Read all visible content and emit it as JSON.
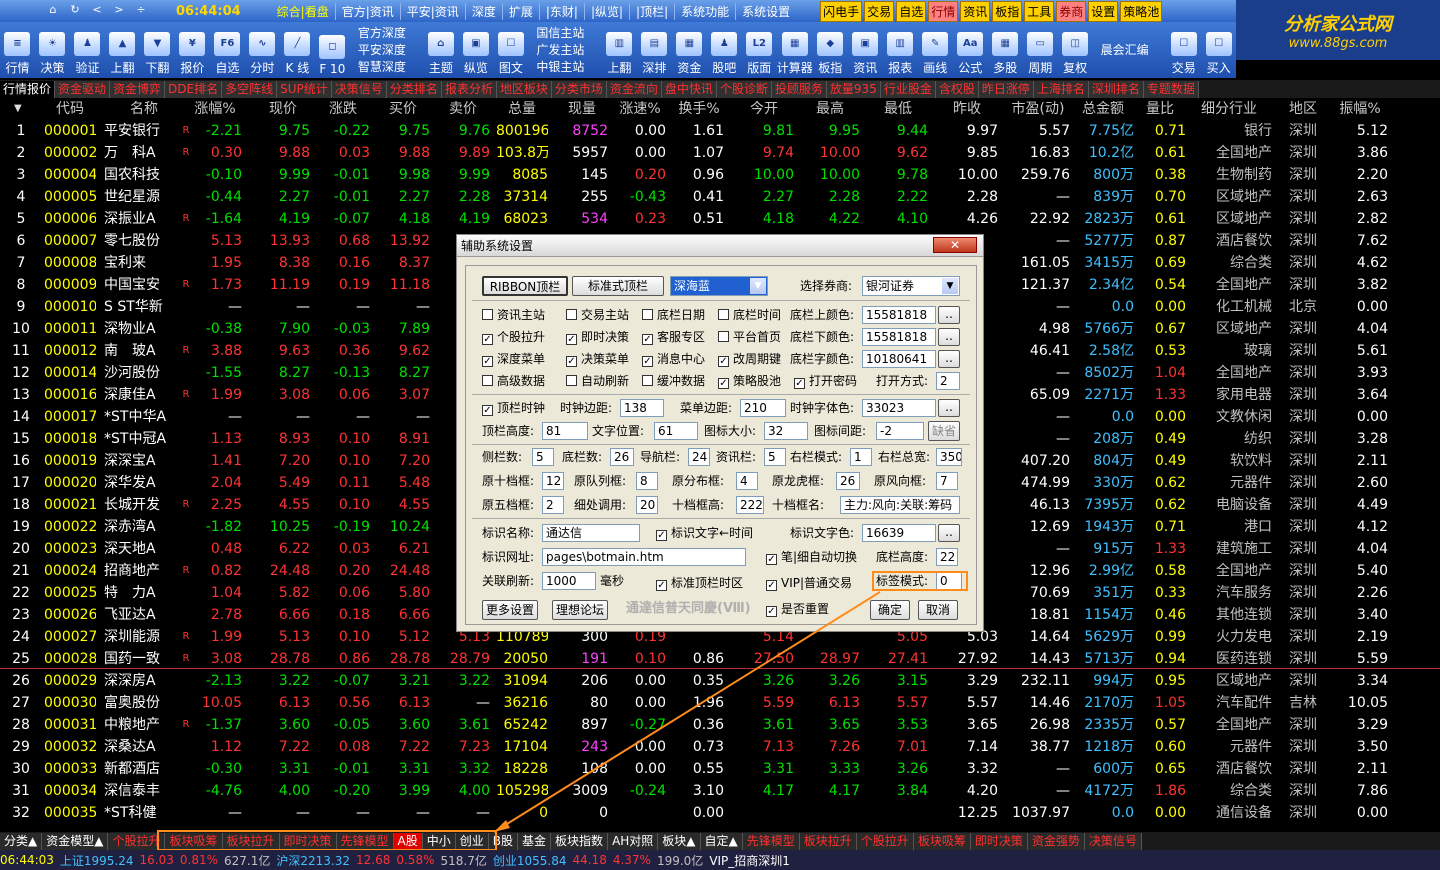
{
  "topbar": {
    "clock": "06:44:04",
    "nav": [
      "⌂",
      "↻",
      "<",
      ">",
      "÷"
    ],
    "menus": [
      "综合|看盘",
      "官方|资讯",
      "平安|资讯",
      "深度",
      "扩展",
      "|东财|",
      "|纵览|",
      "|顶栏|",
      "系统功能",
      "系统设置"
    ],
    "quick": [
      "闪电手",
      "交易",
      "自选",
      "行情",
      "资讯",
      "板指",
      "工具",
      "券商",
      "设置",
      "策略池"
    ]
  },
  "logo": {
    "title": "分析家公式网",
    "url": "www.88gs.com"
  },
  "toolbar": {
    "items1": [
      [
        "行情",
        "≡"
      ],
      [
        "决策",
        "☀"
      ],
      [
        "验证",
        "♟"
      ],
      [
        "上翻",
        "▲"
      ],
      [
        "下翻",
        "▼"
      ],
      [
        "报价",
        "¥"
      ],
      [
        "自选",
        "F6"
      ],
      [
        "分时",
        "∿"
      ],
      [
        "K 线",
        "╱"
      ],
      [
        "F 10",
        "◻"
      ]
    ],
    "stack1": [
      "官方深度",
      "平安深度",
      "智慧深度"
    ],
    "items2": [
      [
        "主题",
        "⌂"
      ],
      [
        "纵览",
        "▣"
      ],
      [
        "图文",
        "☐"
      ]
    ],
    "stack2": [
      "国信主站",
      "广发主站",
      "中银主站"
    ],
    "items3": [
      [
        "上翻",
        "▥"
      ],
      [
        "深排",
        "▤"
      ],
      [
        "资金",
        "▦"
      ],
      [
        "股吧",
        "♟"
      ],
      [
        "版面",
        "L2"
      ],
      [
        "计算器",
        "▦"
      ],
      [
        "板指",
        "◆"
      ],
      [
        "资讯",
        "▣"
      ],
      [
        "报表",
        "▥"
      ],
      [
        "画线",
        "✎"
      ],
      [
        "公式",
        "Aa"
      ],
      [
        "多股",
        "▦"
      ],
      [
        "周期",
        "▭"
      ],
      [
        "复权",
        "◫"
      ]
    ],
    "stack3": [
      "晨会汇编"
    ],
    "items4": [
      [
        "交易",
        "☐"
      ],
      [
        "买入",
        "☐"
      ]
    ]
  },
  "tabs": [
    "行情报价",
    "资金驱动",
    "资金博弈",
    "DDE排名",
    "多空阵线",
    "SUP统计",
    "决策信号",
    "分类排名",
    "报表分析",
    "地区板块",
    "分类市场",
    "资金流向",
    "盘中快讯",
    "个股诊断",
    "投顾服务",
    "放量935",
    "行业股金",
    "含权股",
    "昨日涨停",
    "上海排名",
    "深圳排名",
    "专题数据"
  ],
  "headers": [
    "代码",
    "名称",
    "",
    "涨幅%",
    "现价",
    "涨跌",
    "买价",
    "卖价",
    "总量",
    "现量",
    "涨速%",
    "换手%",
    "今开",
    "最高",
    "最低",
    "昨收",
    "市盈(动)",
    "总金额",
    "量比",
    "细分行业",
    "地区",
    "振幅%"
  ],
  "rows": [
    [
      "1",
      "000001",
      "平安银行",
      "R",
      "-2.21",
      "9.75",
      "-0.22",
      "9.75",
      "9.76",
      "800196",
      "8752",
      "0.00",
      "1.61",
      "9.81",
      "9.95",
      "9.44",
      "9.97",
      "5.57",
      "7.75亿",
      "0.71",
      "银行",
      "深圳",
      "5.12"
    ],
    [
      "2",
      "000002",
      "万　科A",
      "R",
      "0.30",
      "9.88",
      "0.03",
      "9.88",
      "9.89",
      "103.8万",
      "5957",
      "0.00",
      "1.07",
      "9.74",
      "10.00",
      "9.62",
      "9.85",
      "16.83",
      "10.2亿",
      "0.61",
      "全国地产",
      "深圳",
      "3.86"
    ],
    [
      "3",
      "000004",
      "国农科技",
      "",
      "-0.10",
      "9.99",
      "-0.01",
      "9.98",
      "9.99",
      "8085",
      "145",
      "0.20",
      "0.96",
      "10.00",
      "10.00",
      "9.78",
      "10.00",
      "259.76",
      "800万",
      "0.38",
      "生物制药",
      "深圳",
      "2.20"
    ],
    [
      "4",
      "000005",
      "世纪星源",
      "",
      "-0.44",
      "2.27",
      "-0.01",
      "2.27",
      "2.28",
      "37314",
      "255",
      "-0.43",
      "0.41",
      "2.27",
      "2.28",
      "2.22",
      "2.28",
      "—",
      "839万",
      "0.70",
      "区域地产",
      "深圳",
      "2.63"
    ],
    [
      "5",
      "000006",
      "深振业A",
      "R",
      "-1.64",
      "4.19",
      "-0.07",
      "4.18",
      "4.19",
      "68023",
      "534",
      "0.23",
      "0.51",
      "4.18",
      "4.22",
      "4.10",
      "4.26",
      "22.92",
      "2823万",
      "0.61",
      "区域地产",
      "深圳",
      "2.82"
    ],
    [
      "6",
      "000007",
      "零七股份",
      "",
      "5.13",
      "13.93",
      "0.68",
      "13.92",
      "",
      "",
      "",
      "",
      "",
      "",
      "",
      "",
      "",
      "—",
      "5277万",
      "0.87",
      "酒店餐饮",
      "深圳",
      "7.62"
    ],
    [
      "7",
      "000008",
      "宝利来",
      "",
      "1.95",
      "8.38",
      "0.16",
      "8.37",
      "",
      "",
      "",
      "",
      "",
      "",
      "",
      "",
      "",
      "161.05",
      "3415万",
      "0.69",
      "综合类",
      "深圳",
      "4.62"
    ],
    [
      "8",
      "000009",
      "中国宝安",
      "R",
      "1.73",
      "11.19",
      "0.19",
      "11.18",
      "",
      "",
      "",
      "",
      "",
      "",
      "",
      "",
      "",
      "121.37",
      "2.34亿",
      "0.54",
      "全国地产",
      "深圳",
      "3.82"
    ],
    [
      "9",
      "000010",
      "S ST华新",
      "",
      "—",
      "—",
      "—",
      "—",
      "",
      "",
      "",
      "",
      "",
      "",
      "",
      "",
      "",
      "—",
      "0.0",
      "0.00",
      "化工机械",
      "北京",
      "0.00"
    ],
    [
      "10",
      "000011",
      "深物业A",
      "",
      "-0.38",
      "7.90",
      "-0.03",
      "7.89",
      "",
      "",
      "",
      "",
      "",
      "",
      "",
      "",
      "",
      "4.98",
      "5766万",
      "0.67",
      "区域地产",
      "深圳",
      "4.04"
    ],
    [
      "11",
      "000012",
      "南　玻A",
      "R",
      "3.88",
      "9.63",
      "0.36",
      "9.62",
      "",
      "",
      "",
      "",
      "",
      "",
      "",
      "",
      "",
      "46.41",
      "2.58亿",
      "0.53",
      "玻璃",
      "深圳",
      "5.61"
    ],
    [
      "12",
      "000014",
      "沙河股份",
      "",
      "-1.55",
      "8.27",
      "-0.13",
      "8.27",
      "",
      "",
      "",
      "",
      "",
      "",
      "",
      "",
      "",
      "—",
      "8502万",
      "1.04",
      "全国地产",
      "深圳",
      "3.93"
    ],
    [
      "13",
      "000016",
      "深康佳A",
      "R",
      "1.99",
      "3.08",
      "0.06",
      "3.07",
      "",
      "",
      "",
      "",
      "",
      "",
      "",
      "",
      "",
      "65.09",
      "2271万",
      "1.33",
      "家用电器",
      "深圳",
      "3.64"
    ],
    [
      "14",
      "000017",
      "*ST中华A",
      "",
      "—",
      "—",
      "—",
      "—",
      "",
      "",
      "",
      "",
      "",
      "",
      "",
      "",
      "",
      "—",
      "0.0",
      "0.00",
      "文教休闲",
      "深圳",
      "0.00"
    ],
    [
      "15",
      "000018",
      "*ST中冠A",
      "",
      "1.13",
      "8.93",
      "0.10",
      "8.91",
      "",
      "",
      "",
      "",
      "",
      "",
      "",
      "",
      "",
      "—",
      "208万",
      "0.49",
      "纺织",
      "深圳",
      "3.28"
    ],
    [
      "16",
      "000019",
      "深深宝A",
      "",
      "1.41",
      "7.20",
      "0.10",
      "7.20",
      "",
      "",
      "",
      "",
      "",
      "",
      "",
      "",
      "",
      "407.20",
      "804万",
      "0.49",
      "软饮料",
      "深圳",
      "2.11"
    ],
    [
      "17",
      "000020",
      "深华发A",
      "",
      "2.04",
      "5.49",
      "0.11",
      "5.48",
      "",
      "",
      "",
      "",
      "",
      "",
      "",
      "",
      "",
      "474.99",
      "330万",
      "0.62",
      "元器件",
      "深圳",
      "2.60"
    ],
    [
      "18",
      "000021",
      "长城开发",
      "R",
      "2.25",
      "4.55",
      "0.10",
      "4.55",
      "",
      "",
      "",
      "",
      "",
      "",
      "",
      "",
      "",
      "46.13",
      "7395万",
      "0.62",
      "电脑设备",
      "深圳",
      "4.49"
    ],
    [
      "19",
      "000022",
      "深赤湾A",
      "",
      "-1.82",
      "10.25",
      "-0.19",
      "10.24",
      "",
      "",
      "",
      "",
      "",
      "",
      "",
      "",
      "",
      "12.69",
      "1943万",
      "0.71",
      "港口",
      "深圳",
      "4.12"
    ],
    [
      "20",
      "000023",
      "深天地A",
      "",
      "0.48",
      "6.22",
      "0.03",
      "6.21",
      "",
      "",
      "",
      "",
      "",
      "",
      "",
      "",
      "",
      "—",
      "915万",
      "1.33",
      "建筑施工",
      "深圳",
      "4.04"
    ],
    [
      "21",
      "000024",
      "招商地产",
      "R",
      "0.82",
      "24.48",
      "0.20",
      "24.48",
      "",
      "",
      "",
      "",
      "",
      "",
      "",
      "",
      "",
      "12.96",
      "2.99亿",
      "0.58",
      "全国地产",
      "深圳",
      "5.40"
    ],
    [
      "22",
      "000025",
      "特　力A",
      "",
      "1.04",
      "5.82",
      "0.06",
      "5.80",
      "",
      "",
      "",
      "",
      "",
      "",
      "",
      "",
      "",
      "70.69",
      "351万",
      "0.33",
      "汽车服务",
      "深圳",
      "2.26"
    ],
    [
      "23",
      "000026",
      "飞亚达A",
      "",
      "2.78",
      "6.66",
      "0.18",
      "6.66",
      "",
      "",
      "",
      "",
      "",
      "",
      "",
      "",
      "",
      "18.81",
      "1154万",
      "0.46",
      "其他连锁",
      "深圳",
      "3.40"
    ],
    [
      "24",
      "000027",
      "深圳能源",
      "R",
      "1.99",
      "5.13",
      "0.10",
      "5.12",
      "5.13",
      "110789",
      "300",
      "0.19",
      "",
      "5.14",
      "",
      "5.05",
      "5.03",
      "14.64",
      "5629万",
      "0.99",
      "火力发电",
      "深圳",
      "2.19"
    ],
    [
      "25",
      "000028",
      "国药一致",
      "R",
      "3.08",
      "28.78",
      "0.86",
      "28.78",
      "28.79",
      "20050",
      "191",
      "0.10",
      "0.86",
      "27.50",
      "28.97",
      "27.41",
      "27.92",
      "14.43",
      "5713万",
      "0.94",
      "医药连锁",
      "深圳",
      "5.59"
    ],
    [
      "26",
      "000029",
      "深深房A",
      "",
      "-2.13",
      "3.22",
      "-0.07",
      "3.21",
      "3.22",
      "31094",
      "206",
      "0.00",
      "0.35",
      "3.26",
      "3.26",
      "3.15",
      "3.29",
      "232.11",
      "994万",
      "0.95",
      "区域地产",
      "深圳",
      "3.34"
    ],
    [
      "27",
      "000030",
      "富奥股份",
      "",
      "10.05",
      "6.13",
      "0.56",
      "6.13",
      "—",
      "36216",
      "80",
      "0.00",
      "1.96",
      "5.59",
      "6.13",
      "5.57",
      "5.57",
      "14.46",
      "2170万",
      "1.05",
      "汽车配件",
      "吉林",
      "10.05"
    ],
    [
      "28",
      "000031",
      "中粮地产",
      "R",
      "-1.37",
      "3.60",
      "-0.05",
      "3.60",
      "3.61",
      "65242",
      "897",
      "-0.27",
      "0.36",
      "3.61",
      "3.65",
      "3.53",
      "3.65",
      "26.98",
      "2335万",
      "0.57",
      "全国地产",
      "深圳",
      "3.29"
    ],
    [
      "29",
      "000032",
      "深桑达A",
      "",
      "1.12",
      "7.22",
      "0.08",
      "7.22",
      "7.23",
      "17104",
      "243",
      "0.00",
      "0.73",
      "7.13",
      "7.26",
      "7.01",
      "7.14",
      "38.77",
      "1218万",
      "0.60",
      "元器件",
      "深圳",
      "3.50"
    ],
    [
      "30",
      "000033",
      "新都酒店",
      "",
      "-0.30",
      "3.31",
      "-0.01",
      "3.31",
      "3.32",
      "18228",
      "108",
      "0.00",
      "0.55",
      "3.31",
      "3.33",
      "3.26",
      "3.32",
      "—",
      "600万",
      "0.65",
      "酒店餐饮",
      "深圳",
      "2.11"
    ],
    [
      "31",
      "000034",
      "深信泰丰",
      "",
      "-4.76",
      "4.00",
      "-0.20",
      "3.99",
      "4.00",
      "105298",
      "3009",
      "-0.24",
      "3.10",
      "4.17",
      "4.17",
      "3.84",
      "4.20",
      "—",
      "4172万",
      "1.86",
      "综合类",
      "深圳",
      "7.86"
    ],
    [
      "32",
      "000035",
      "*ST科健",
      "",
      "—",
      "—",
      "—",
      "—",
      "—",
      "0",
      "0",
      "",
      "0.00",
      "",
      "",
      "",
      "12.25",
      "1037.97",
      "0.0",
      "0.00",
      "通信设备",
      "深圳",
      "0.00"
    ]
  ],
  "bottomtabs": [
    "分类▲",
    "资金模型▲",
    "个股拉升",
    "板块吸筹",
    "板块拉升",
    "即时决策",
    "先锋模型",
    "A股",
    "中小",
    "创业",
    "B股",
    "基金",
    "板块指数",
    "AH对照",
    "板块▲",
    "自定▲",
    "先锋模型",
    "板块拉升",
    "个股拉升",
    "板块吸筹",
    "即时决策",
    "资金强势",
    "决策信号"
  ],
  "status": {
    "time": "06:44:03",
    "sh": "上证1995.24",
    "sh_chg": "16.03",
    "sh_pct": "0.81%",
    "sh_amt": "627.1亿",
    "hs": "沪深2213.32",
    "hs_chg": "12.68",
    "hs_pct": "0.58%",
    "hs_amt": "518.7亿",
    "cy": "创业1055.84",
    "cy_chg": "44.18",
    "cy_pct": "4.37%",
    "cy_amt": "199.0亿",
    "broker": "VIP_招商深圳1"
  },
  "dialog": {
    "title": "辅助系统设置",
    "close": "✕",
    "btn_ribbon": "RIBBON顶栏",
    "btn_std": "标准式顶栏",
    "theme": "深海蓝",
    "broker_label": "选择券商:",
    "broker": "银河证券",
    "c1": [
      "资讯主站",
      "交易主站",
      "底栏日期",
      "底栏时间"
    ],
    "bottom_up_label": "底栏上颜色:",
    "bottom_up": "15581818",
    "c2": [
      "个股拉升",
      "即时决策",
      "客服专区",
      "平台首页"
    ],
    "bottom_down_label": "底栏下颜色:",
    "bottom_down": "15581818",
    "c3": [
      "深度菜单",
      "决策菜单",
      "消息中心",
      "改周期键"
    ],
    "bottom_font_label": "底栏字颜色:",
    "bottom_font": "10180641",
    "c4": [
      "高级数据",
      "自动刷新",
      "缓冲数据",
      "策略股池",
      "打开密码"
    ],
    "open_mode_label": "打开方式:",
    "open_mode": "2",
    "clock_label": "顶栏时钟",
    "clock_margin_label": "时钟边距:",
    "clock_margin": "138",
    "menu_margin_label": "菜单边距:",
    "menu_margin": "210",
    "clock_font_label": "时钟字体色:",
    "clock_font": "33023",
    "top_h_label": "顶栏高度:",
    "top_h": "81",
    "text_pos_label": "文字位置:",
    "text_pos": "61",
    "icon_size_label": "图标大小:",
    "icon_size": "32",
    "icon_gap_label": "图标间距:",
    "icon_gap": "-2",
    "default": "缺省",
    "side_label": "侧栏数:",
    "side": "5",
    "bottom_cnt_label": "底栏数:",
    "bottom_cnt": "26",
    "nav_label": "导航栏:",
    "nav": "24",
    "info_label": "资讯栏:",
    "info": "5",
    "right_mode_label": "右栏模式:",
    "right_mode": "1",
    "right_total_label": "右栏总宽:",
    "right_total": "350",
    "r10_label": "原十档框:",
    "r10": "12",
    "rq_label": "原队列框:",
    "rq": "8",
    "rd_label": "原分布框:",
    "rd": "4",
    "rl_label": "原龙虎框:",
    "rl": "26",
    "rr_label": "原风向框:",
    "rr": "7",
    "r5_label": "原五档框:",
    "r5": "2",
    "tune_label": "细处调用:",
    "tune": "20",
    "ten_h_label": "十档框高:",
    "ten_h": "222",
    "ten_name_label": "十档框名:",
    "ten_name": "主力:风向:关联:筹码",
    "mark_name_label": "标识名称:",
    "mark_name": "通达信",
    "mark_time": "标识文字←时间",
    "mark_color_label": "标识文字色:",
    "mark_color": "16639",
    "mark_url_label": "标识网址:",
    "mark_url": "pages\\botmain.htm",
    "pen_auto": "笔|细自动切换",
    "bottom_h_label": "底栏高度:",
    "bottom_h": "22",
    "rel_refresh_label": "关联刷新:",
    "rel_refresh": "1000",
    "ms": "毫秒",
    "std_top": "标准顶栏时区",
    "vip": "VIP|普通交易",
    "sign_mode_label": "标签模式:",
    "sign_mode": "0",
    "more": "更多设置",
    "forum": "理想论坛",
    "brand": "通達信普天同慶(Ⅷ)",
    "reset": "是否重置",
    "ok": "确定",
    "cancel": "取消"
  },
  "colors": {
    "accent": "#ff8c1a",
    "red": "#ff3333",
    "green": "#00e000"
  }
}
